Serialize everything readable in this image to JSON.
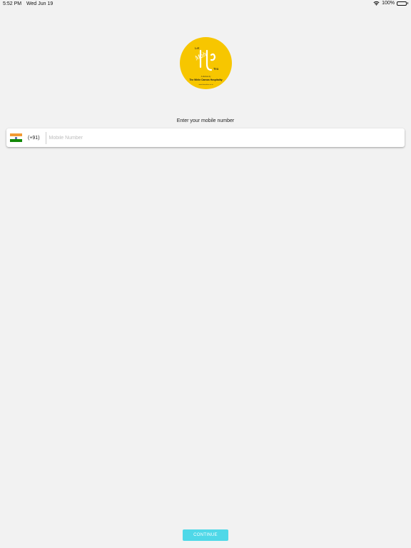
{
  "status_bar": {
    "time": "5:52 PM",
    "date": "Wed Jun 19",
    "battery_percent": "100%",
    "battery_level": 1.0,
    "icons": [
      "wifi-icon",
      "battery-icon"
    ]
  },
  "logo": {
    "text_top": "Let",
    "text_main": "Mah",
    "text_corner": "Tea",
    "brand_line1": "A Venture by",
    "brand_line2": "The White Canvas Hospitality",
    "website": "www.letmahtea.co.in",
    "background_color": "#f7c600"
  },
  "login": {
    "prompt": "Enter your mobile number",
    "country_code": "(+91)",
    "mobile_value": "",
    "mobile_placeholder": "Mobile Number",
    "flag": "india-flag-icon"
  },
  "actions": {
    "continue_label": "CONTINUE",
    "continue_color": "#4fd8e8"
  },
  "colors": {
    "background": "#f2f2f2",
    "flag_saffron": "#f29a33",
    "flag_white": "#ffffff",
    "flag_green": "#138808"
  }
}
